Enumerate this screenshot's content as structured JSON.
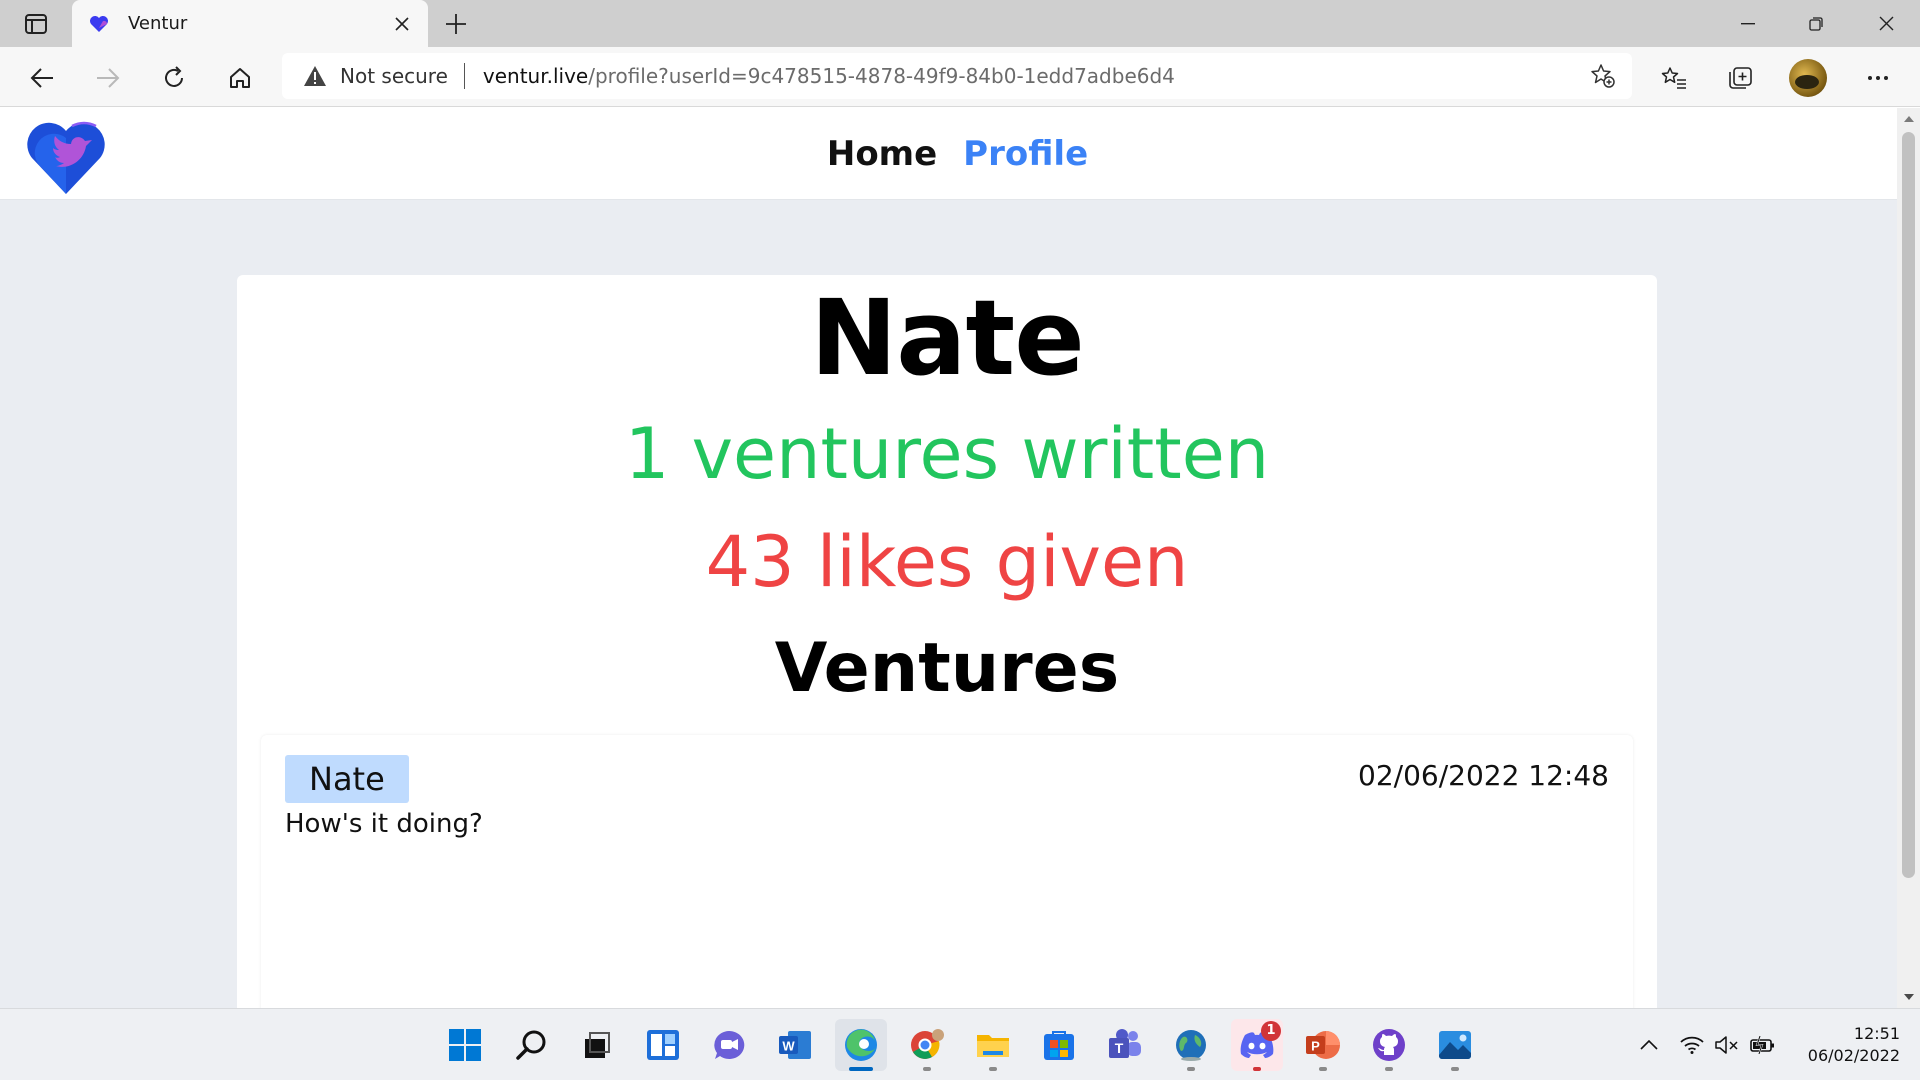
{
  "browser": {
    "tab_title": "Ventur",
    "address": {
      "security_label": "Not secure",
      "url_host": "ventur.live",
      "url_path": "/profile?userId=9c478515-4878-49f9-84b0-1edd7adbe6d4"
    }
  },
  "site": {
    "nav": {
      "home": "Home",
      "profile": "Profile"
    }
  },
  "profile": {
    "name": "Nate",
    "ventures_written": "1 ventures written",
    "likes_given": "43 likes given",
    "section_title": "Ventures"
  },
  "ventures": [
    {
      "author": "Nate",
      "timestamp": "02/06/2022 12:48",
      "text": "How's it doing?"
    }
  ],
  "taskbar": {
    "apps": [
      "start-icon",
      "search-icon",
      "task-view-icon",
      "widgets-icon",
      "chat-icon",
      "word-icon",
      "edge-icon",
      "chrome-icon",
      "file-explorer-icon",
      "store-icon",
      "teams-icon",
      "globe-icon",
      "discord-icon",
      "powerpoint-icon",
      "github-icon",
      "photos-icon"
    ],
    "discord_badge": "1",
    "time": "12:51",
    "date": "06/02/2022"
  },
  "colors": {
    "accent": "#3b82f6",
    "ventures_stat": "#22c55e",
    "likes_stat": "#ef4444",
    "author_chip": "#bfdbfe",
    "page_bg": "#eaedf2"
  }
}
